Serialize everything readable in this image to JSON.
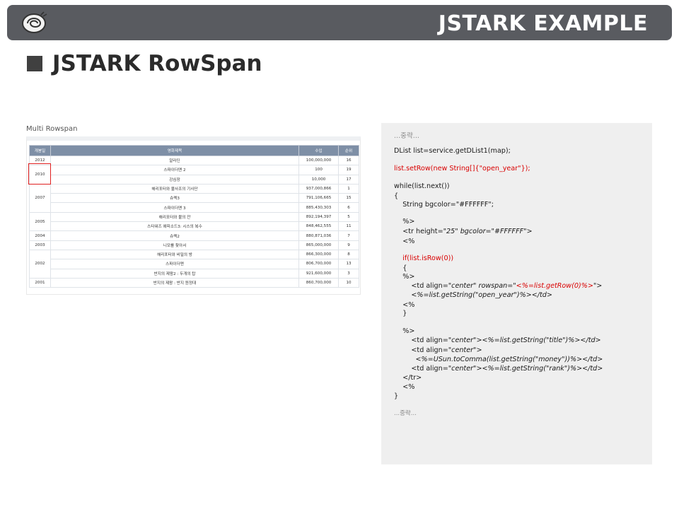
{
  "header": {
    "brand": "JSTARK EXAMPLE",
    "logo_icon": "snail-icon"
  },
  "page": {
    "title": "JSTARK RowSpan"
  },
  "table_panel": {
    "title": "Multi Rowspan",
    "columns": [
      "개봉일",
      "영화제목",
      "수입",
      "순위"
    ],
    "rows": [
      {
        "year": "2012",
        "title": "알라딘",
        "money": "100,000,000",
        "rank": "16"
      },
      {
        "year": "2010",
        "title": "스파이더맨 2",
        "money": "100",
        "rank": "19"
      },
      {
        "year": "",
        "title": "강심장",
        "money": "10,000",
        "rank": "17"
      },
      {
        "year": "",
        "title": "해리포터와 불사조의 기사단",
        "money": "937,000,866",
        "rank": "1"
      },
      {
        "year": "2007",
        "title": "슈렉3",
        "money": "791,106,665",
        "rank": "15"
      },
      {
        "year": "",
        "title": "스파이더맨 3",
        "money": "885,430,303",
        "rank": "6"
      },
      {
        "year": "2005",
        "title": "해리포터와 불의 잔",
        "money": "892,194,397",
        "rank": "5"
      },
      {
        "year": "",
        "title": "스타워즈 에피소드3: 시스의 복수",
        "money": "848,462,555",
        "rank": "11"
      },
      {
        "year": "2004",
        "title": "슈렉2",
        "money": "880,871,036",
        "rank": "7"
      },
      {
        "year": "2003",
        "title": "니모를 찾아서",
        "money": "865,000,000",
        "rank": "9"
      },
      {
        "year": "2002",
        "title": "해리포터와 비밀의 방",
        "money": "866,300,000",
        "rank": "8"
      },
      {
        "year": "",
        "title": "스파이더맨",
        "money": "806,700,000",
        "rank": "13"
      },
      {
        "year": "",
        "title": "반지의 제왕2 : 두개의 탑",
        "money": "921,600,000",
        "rank": "3"
      },
      {
        "year": "2001",
        "title": "반지의 제왕 : 반지 원정대",
        "money": "860,700,000",
        "rank": "10"
      }
    ]
  },
  "code": {
    "l01": "...중략...",
    "l02": "DList list=service.getDList1(map);",
    "l03": "list.setRow(new String[]{\"open_year\"});",
    "l04": "while(list.next())",
    "l05": "{",
    "l06": "    String bgcolor=\"#FFFFFF\";",
    "l07": "    %>",
    "l08a": "    <tr height=",
    "l08b": "\"25\" bgcolor=\"#FFFFFF\">",
    "l09": "    <%",
    "l10": "    if(list.isRow(0))",
    "l11": "    {",
    "l12": "    %>",
    "l13a": "        <td align=",
    "l13b": "\"center\" rowspan=\"",
    "l13c": "<%=list.getRow(0)%>",
    "l13d": "\">",
    "l14": "        <%=list.getString(\"open_year\")%></td>",
    "l15": "    <%",
    "l16": "    }",
    "l17": "    %>",
    "l18a": "        <td align=",
    "l18b": "\"center\"><%=list.getString(\"title\")%></td>",
    "l19a": "        <td align=",
    "l19b": "\"center\">",
    "l20": "          <%=USun.toComma(list.getString(\"money\"))%></td>",
    "l21a": "        <td align=",
    "l21b": "\"center\"><%=list.getString(\"rank\")%></td>",
    "l22": "    </tr>",
    "l23": "    <%",
    "l24": "}",
    "l25": "...중략..."
  }
}
